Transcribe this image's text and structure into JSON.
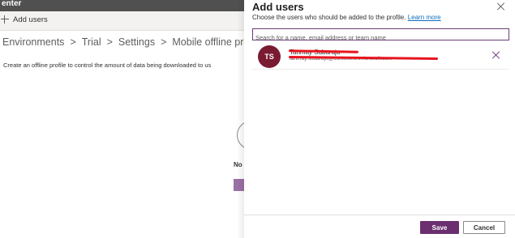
{
  "app": {
    "title_fragment": "enter"
  },
  "command_bar": {
    "add_users_label": "Add users"
  },
  "breadcrumb": {
    "items": [
      "Environments",
      "Trial",
      "Settings",
      "Mobile offline profiles"
    ],
    "separator": ">"
  },
  "page": {
    "description": "Create an offline profile to control the amount of data being downloaded to us",
    "empty_state_text": "No"
  },
  "panel": {
    "title": "Add users",
    "subtitle": "Choose the users who should be added to the profile.",
    "learn_more": "Learn more",
    "search_placeholder": "Search for a name, email address or team name",
    "selected_users": [
      {
        "initials": "TS",
        "name": "Tanmay Subaraju",
        "email": "tanmay.subaraju@contoso.onmicrosoft.com",
        "avatar_color": "#7a1b32"
      }
    ],
    "save_label": "Save",
    "cancel_label": "Cancel"
  },
  "colors": {
    "accent": "#6b2f70",
    "link": "#0f6cbd",
    "redaction": "#e8141e"
  }
}
